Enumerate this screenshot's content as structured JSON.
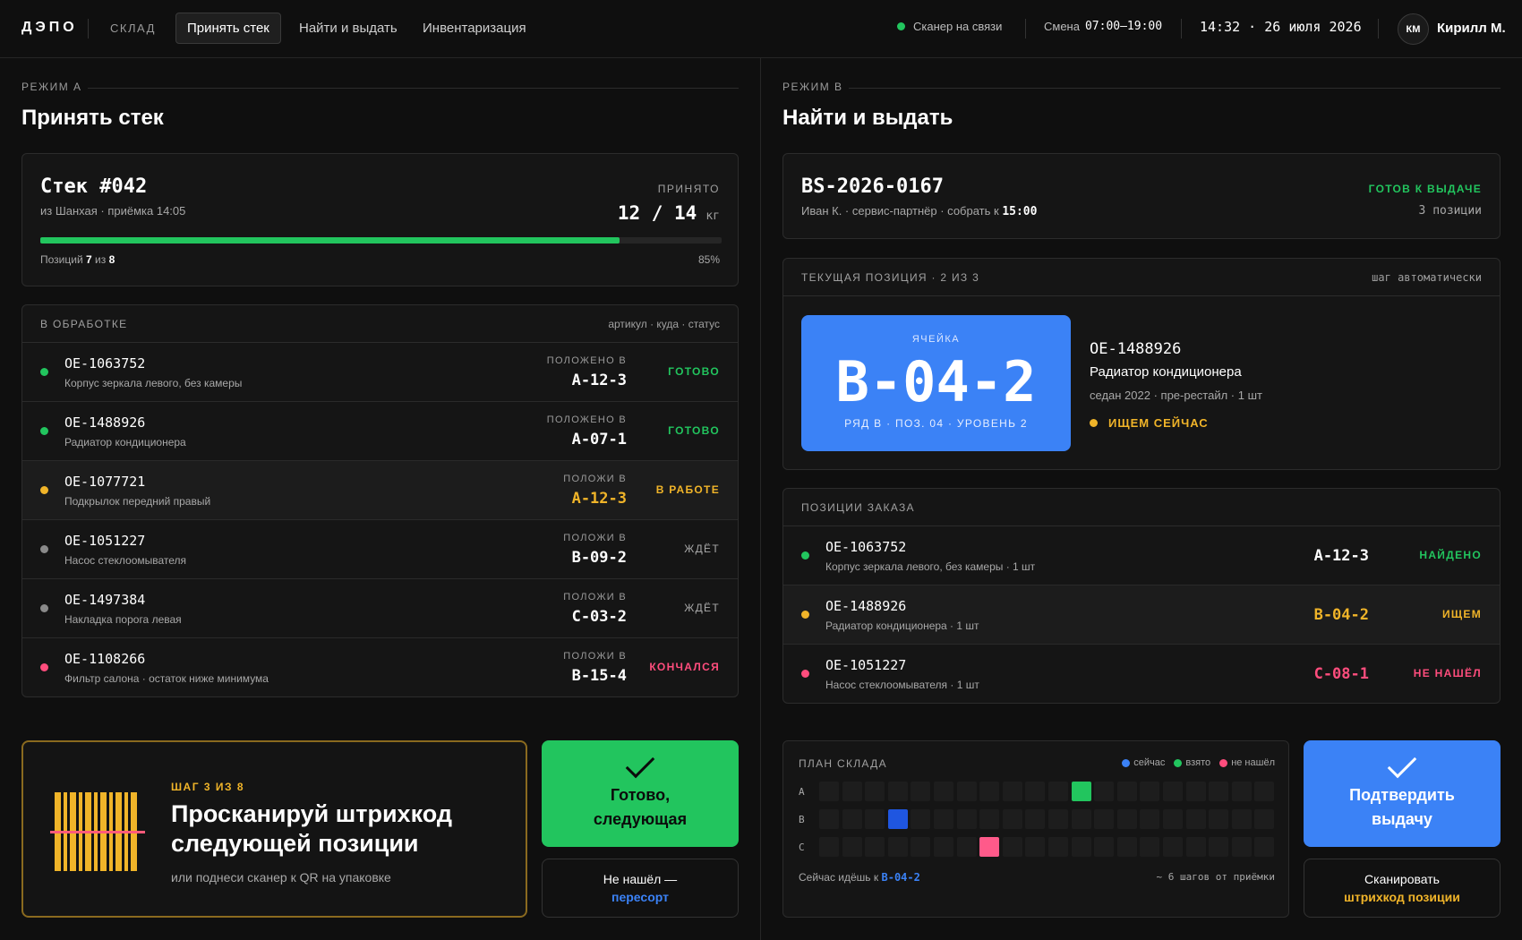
{
  "topbar": {
    "logo": "ДЭПО",
    "section": "СКЛАД",
    "tabs": [
      {
        "label": "Принять стек",
        "active": true
      },
      {
        "label": "Найти и выдать",
        "active": false
      },
      {
        "label": "Инвентаризация",
        "active": false
      }
    ],
    "scanner_status": "Сканер на связи",
    "shift_label": "Смена",
    "shift_hours": "07:00–19:00",
    "datetime": "14:32 · 26 июля 2026",
    "user_initials": "КМ",
    "user_name": "Кирилл М."
  },
  "mode_a": {
    "label": "РЕЖИМ А",
    "title": "Принять стек",
    "stack": {
      "title": "Стек #042",
      "subtitle": "из Шанхая · приёмка 14:05",
      "accepted_label": "ПРИНЯТО",
      "weight": "12 / 14",
      "weight_unit": "кг",
      "progress": 0.85,
      "positions_prefix": "Позиций",
      "positions_done": "7",
      "positions_mid": "из",
      "positions_total": "8",
      "percent": "85%"
    },
    "processing": {
      "header": "В ОБРАБОТКЕ",
      "header_right": "артикул · куда · статус",
      "rows": [
        {
          "art": "OE-1063752",
          "desc": "Корпус зеркала левого, без камеры",
          "place_label": "ПОЛОЖЕНО В",
          "cell": "A-12-3",
          "status": "ГОТОВО",
          "dot": "green",
          "status_color": "green"
        },
        {
          "art": "OE-1488926",
          "desc": "Радиатор кондиционера",
          "place_label": "ПОЛОЖЕНО В",
          "cell": "A-07-1",
          "status": "ГОТОВО",
          "dot": "green",
          "status_color": "green"
        },
        {
          "art": "OE-1077721",
          "desc": "Подкрылок передний правый",
          "place_label": "ПОЛОЖИ В",
          "cell": "A-12-3",
          "status": "В РАБОТЕ",
          "dot": "yellow",
          "status_color": "yellow",
          "highlight": true
        },
        {
          "art": "OE-1051227",
          "desc": "Насос стеклоомывателя",
          "place_label": "ПОЛОЖИ В",
          "cell": "B-09-2",
          "status": "ЖДЁТ",
          "dot": "gray",
          "status_color": "gray"
        },
        {
          "art": "OE-1497384",
          "desc": "Накладка порога левая",
          "place_label": "ПОЛОЖИ В",
          "cell": "C-03-2",
          "status": "ЖДЁТ",
          "dot": "gray",
          "status_color": "gray"
        },
        {
          "art": "OE-1108266",
          "desc": "Фильтр салона · остаток ниже минимума",
          "place_label": "ПОЛОЖИ В",
          "cell": "B-15-4",
          "status": "КОНЧАЛСЯ",
          "dot": "pink",
          "status_color": "pink"
        }
      ]
    },
    "scan_prompt": {
      "step": "ШАГ 3 ИЗ 8",
      "title_line1": "Просканируй штрихкод",
      "title_line2": "следующей позиции",
      "hint": "или поднеси сканер к QR на упаковке"
    },
    "done_button": {
      "line1": "Готово,",
      "line2": "следующая"
    },
    "notfound_button": {
      "line1": "Не нашёл —",
      "line2": "пересорт"
    }
  },
  "mode_b": {
    "label": "РЕЖИМ В",
    "title": "Найти и выдать",
    "order": {
      "id": "BS-2026-0167",
      "meta_prefix": "Иван К. · сервис-партнёр · собрать к",
      "meta_time": "15:00",
      "status": "ГОТОВ К ВЫДАЧЕ",
      "positions": "3 позиции"
    },
    "current": {
      "header": "ТЕКУЩАЯ ПОЗИЦИЯ · 2 ИЗ 3",
      "header_right": "шаг автоматически",
      "cell_label": "ЯЧЕЙКА",
      "cell": "B-04-2",
      "cell_sub": "РЯД B · ПОЗ. 04 · УРОВЕНЬ 2",
      "art": "OE-1488926",
      "name": "Радиатор кондиционера",
      "meta": "седан 2022 · пре-рестайл · 1 шт",
      "status": "ИЩЕМ СЕЙЧАС"
    },
    "order_items": {
      "header": "ПОЗИЦИИ ЗАКАЗА",
      "rows": [
        {
          "art": "OE-1063752",
          "desc": "Корпус зеркала левого, без камеры · 1 шт",
          "cell": "A-12-3",
          "cell_color": "#ffffff",
          "status": "НАЙДЕНО",
          "dot": "green",
          "status_color": "green"
        },
        {
          "art": "OE-1488926",
          "desc": "Радиатор кондиционера · 1 шт",
          "cell": "B-04-2",
          "cell_color": "#f0b429",
          "status": "ИЩЕМ",
          "dot": "yellow",
          "status_color": "yellow",
          "highlight": true
        },
        {
          "art": "OE-1051227",
          "desc": "Насос стеклоомывателя · 1 шт",
          "cell": "C-08-1",
          "cell_color": "#ff4d7d",
          "status": "НЕ НАШЁЛ",
          "dot": "pink",
          "status_color": "pink"
        }
      ]
    },
    "map": {
      "header": "ПЛАН СКЛАДА",
      "legend": [
        {
          "label": "сейчас",
          "color": "blue"
        },
        {
          "label": "взято",
          "color": "green"
        },
        {
          "label": "не нашёл",
          "color": "pink"
        }
      ],
      "rows": [
        "A",
        "B",
        "C"
      ],
      "columns": 20,
      "marks": [
        {
          "row": 0,
          "col": 11,
          "kind": "taken"
        },
        {
          "row": 1,
          "col": 3,
          "kind": "cur"
        },
        {
          "row": 2,
          "col": 7,
          "kind": "miss"
        }
      ],
      "footer_prefix": "Сейчас идёшь к",
      "footer_cell": "B-04-2",
      "footer_right": "~ 6 шагов от приёмки"
    },
    "confirm_button": {
      "line1": "Подтвердить",
      "line2": "выдачу"
    },
    "scan_button": {
      "line1": "Сканировать",
      "line2": "штрихкод позиции"
    }
  },
  "colors": {
    "accent_green": "#22c55e",
    "accent_blue": "#3b82f6",
    "accent_yellow": "#f0b429",
    "accent_pink": "#ff4d7d"
  }
}
